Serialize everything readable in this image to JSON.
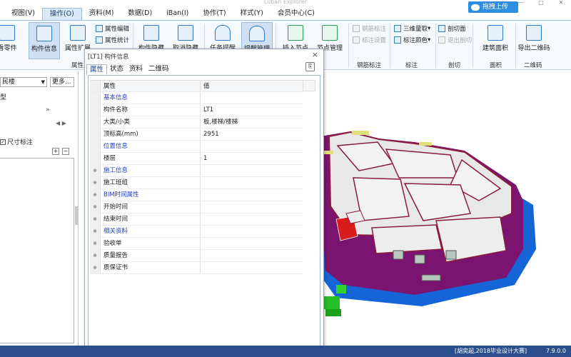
{
  "window": {
    "title": "Luban Explorer",
    "controls": [
      "—",
      "□",
      "✕"
    ]
  },
  "menubar": {
    "items": [
      "视图(V)",
      "操作(O)",
      "资料(M)",
      "数据(D)",
      "iBan(I)",
      "协作(T)",
      "样式(Y)",
      "会员中心(C)"
    ],
    "active_index": 1,
    "upload_label": "拖拽上传"
  },
  "ribbon": {
    "big_buttons": [
      "看零件",
      "构件信息",
      "属性扩展",
      "构件隐藏",
      "取消隐藏",
      "任务提醒",
      "提醒管理",
      "插入节点",
      "节点管理",
      "建筑面积",
      "导出二维码"
    ],
    "small_buttons": {
      "attr_edit": "属性编辑",
      "attr_stat": "属性统计",
      "rebar_mark": "钢筋标注",
      "mark_setting": "标注设置",
      "three_dim": "三维量取",
      "mark_color": "标注颜色",
      "section_face": "剖切面",
      "exit_section": "退出剖切"
    },
    "groups": [
      "属性",
      "钢筋标注",
      "标注",
      "剖切",
      "面积",
      "二维码"
    ]
  },
  "left_panel": {
    "floor_select": "民楼",
    "more_label": "更多...",
    "type_label": "型",
    "collapse_glyph": "»",
    "nav_glyphs": "◀ ▶",
    "dim_check_label": "尺寸标注",
    "plus": "+",
    "minus": "−"
  },
  "dialog": {
    "title": "[LT1] 构件信息",
    "close_glyph": "×",
    "tabs": [
      "属性",
      "状态",
      "资料",
      "二维码"
    ],
    "active_tab": 0,
    "grid": {
      "header_key": "属性",
      "header_value": "值",
      "rows": [
        {
          "key": "基本信息",
          "value": "",
          "category": true,
          "expander": ""
        },
        {
          "key": "构件名称",
          "value": "LT1",
          "category": false,
          "expander": ""
        },
        {
          "key": "大类/小类",
          "value": "板,楼梯/楼梯",
          "category": false,
          "expander": ""
        },
        {
          "key": "顶标高(mm)",
          "value": "2951",
          "category": false,
          "expander": ""
        },
        {
          "key": "位置信息",
          "value": "",
          "category": true,
          "expander": ""
        },
        {
          "key": "楼层",
          "value": "1",
          "category": false,
          "expander": ""
        },
        {
          "key": "施工信息",
          "value": "",
          "category": true,
          "expander": "※"
        },
        {
          "key": "施工班组",
          "value": "",
          "category": false,
          "expander": "※"
        },
        {
          "key": "BIM时间属性",
          "value": "",
          "category": true,
          "expander": "※"
        },
        {
          "key": "开始时间",
          "value": "",
          "category": false,
          "expander": "※"
        },
        {
          "key": "结束时间",
          "value": "",
          "category": false,
          "expander": "※"
        },
        {
          "key": "相关资料",
          "value": "",
          "category": true,
          "expander": "※"
        },
        {
          "key": "验收单",
          "value": "",
          "category": false,
          "expander": "※"
        },
        {
          "key": "质量报告",
          "value": "",
          "category": false,
          "expander": "※"
        },
        {
          "key": "质保证书",
          "value": "",
          "category": false,
          "expander": "※"
        }
      ]
    }
  },
  "status_bar": {
    "author": "[胡奕超,2018毕业设计大赛]",
    "version": "7.9.0.0"
  },
  "colors": {
    "wall": "#7a1470",
    "slab_top": "#ececec",
    "base": "#1565d8",
    "beam": "#e0e07a",
    "stair": "#d81b1b",
    "status_bar": "#2b4f8c",
    "accent": "#2d8de0"
  }
}
